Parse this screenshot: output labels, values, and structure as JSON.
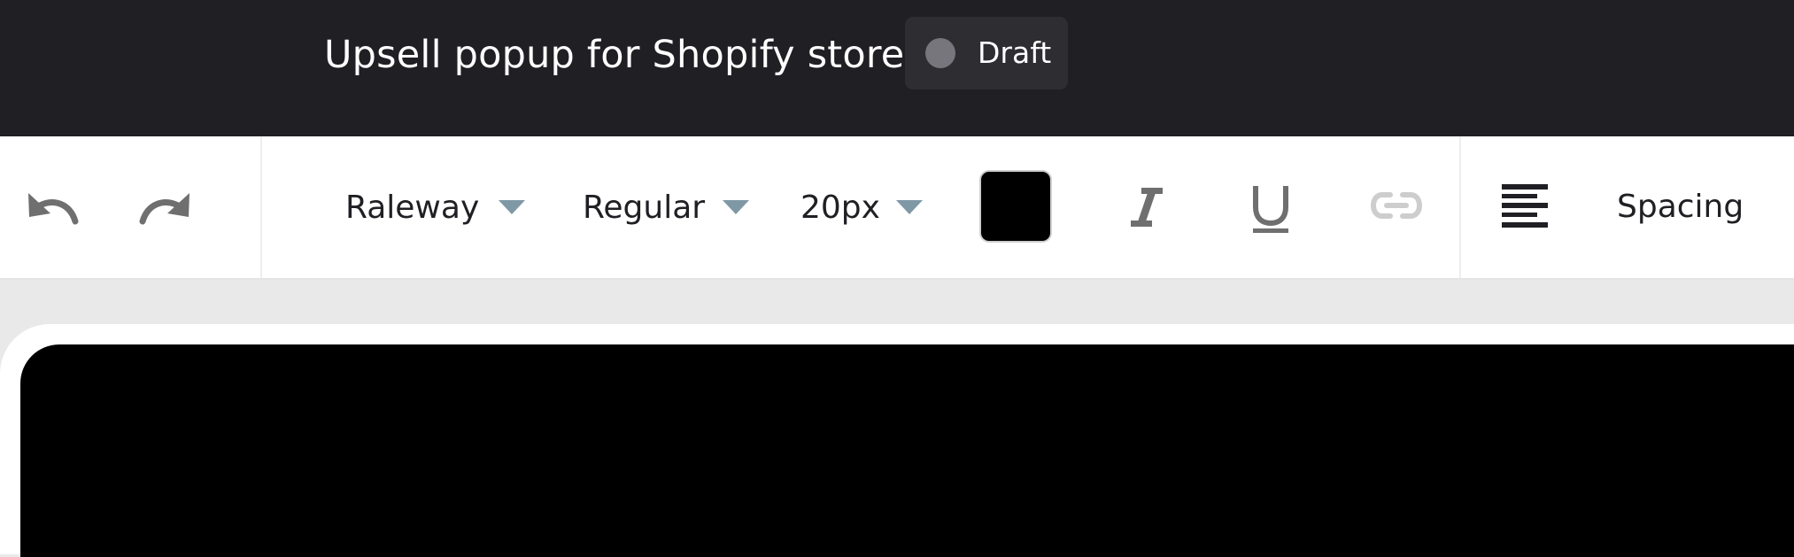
{
  "header": {
    "title": "Upsell popup for Shopify store",
    "status": {
      "label": "Draft",
      "dot_color": "#77767c"
    }
  },
  "toolbar": {
    "history": {
      "undo_icon": "undo-icon",
      "redo_icon": "redo-icon"
    },
    "font_family": {
      "value": "Raleway"
    },
    "font_weight": {
      "value": "Regular"
    },
    "font_size": {
      "value": "20px"
    },
    "text_color": {
      "value": "#000000"
    },
    "formatting": {
      "italic_icon": "italic-icon",
      "underline_icon": "underline-icon",
      "link_icon": "link-icon"
    },
    "alignment": {
      "icon": "align-left-icon"
    },
    "spacing_label": "Spacing"
  },
  "colors": {
    "topbar_bg": "#1f1f24",
    "caret": "#7f98a6",
    "canvas_bg": "#e9e9e9"
  }
}
